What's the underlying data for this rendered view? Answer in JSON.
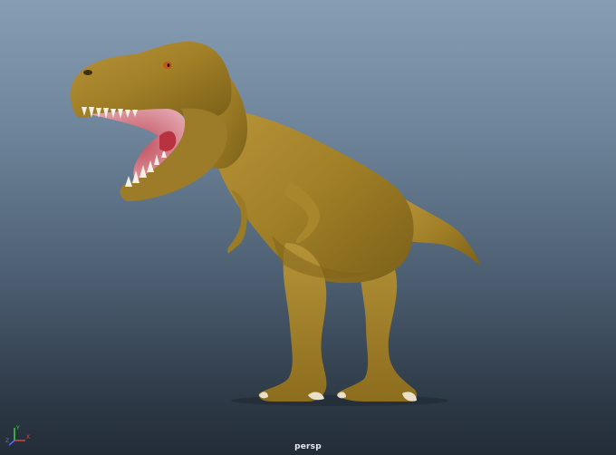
{
  "viewport": {
    "camera_label": "persp",
    "background_top": "#869db4",
    "background_bottom": "#232d38"
  },
  "axis_gizmo": {
    "x_label": "X",
    "y_label": "Y",
    "z_label": "Z",
    "x_color": "#e04040",
    "y_color": "#40d040",
    "z_color": "#4a70ff"
  },
  "model": {
    "name": "tyrannosaurus-rex-model",
    "skin_color": "#a8862c",
    "mouth_color": "#d58a94"
  }
}
